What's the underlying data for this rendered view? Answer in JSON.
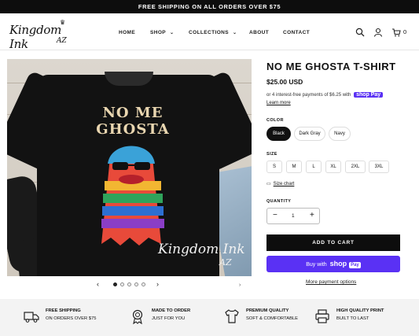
{
  "announcement": "FREE SHIPPING ON ALL ORDERS OVER $75",
  "logo": {
    "line1": "Kingdom Ink",
    "line2": "AZ"
  },
  "nav": [
    {
      "label": "HOME"
    },
    {
      "label": "SHOP"
    },
    {
      "label": "COLLECTIONS"
    },
    {
      "label": "ABOUT"
    },
    {
      "label": "CONTACT"
    }
  ],
  "header_icons": [
    "search-icon",
    "account-icon",
    "cart-icon"
  ],
  "cart_count": "0",
  "product_image": {
    "shirt_text": "NO ME GHOSTA",
    "watermark_line1": "Kingdom Ink",
    "watermark_line2": "AZ"
  },
  "carousel": {
    "slides": 5,
    "active": 0
  },
  "product": {
    "title": "NO ME GHOSTA T-SHIRT",
    "price": "$25.00 USD",
    "installments_text": "or 4 interest-free payments of $6.25 with",
    "shop_pay": "shop Pay",
    "learn_more": "Learn more",
    "color_label": "COLOR",
    "colors": [
      "Black",
      "Dark Gray",
      "Navy"
    ],
    "selected_color": "Black",
    "size_label": "SIZE",
    "sizes": [
      "S",
      "M",
      "L",
      "XL",
      "2XL",
      "3XL"
    ],
    "size_chart": "Size chart",
    "quantity_label": "QUANTITY",
    "quantity": "1",
    "add_to_cart": "ADD TO CART",
    "buy_now_prefix": "Buy with",
    "buy_now_shop": "shop",
    "buy_now_pay": "Pay",
    "more_payment": "More payment options"
  },
  "features": [
    {
      "icon": "truck-icon",
      "title": "FREE SHIPPING",
      "subtitle": "ON ORDERS OVER $75"
    },
    {
      "icon": "ribbon-icon",
      "title": "MADE TO ORDER",
      "subtitle": "JUST FOR YOU"
    },
    {
      "icon": "tshirt-icon",
      "title": "PREMIUM QUALITY",
      "subtitle": "SOFT & COMFORTABLE"
    },
    {
      "icon": "printer-icon",
      "title": "HIGH QUALITY PRINT",
      "subtitle": "BUILT TO LAST"
    }
  ],
  "colors_used": {
    "accent_shop_pay": "#5a31f4",
    "button_dark": "#0d0d0d",
    "shirt_text": "#e9d6b0"
  }
}
